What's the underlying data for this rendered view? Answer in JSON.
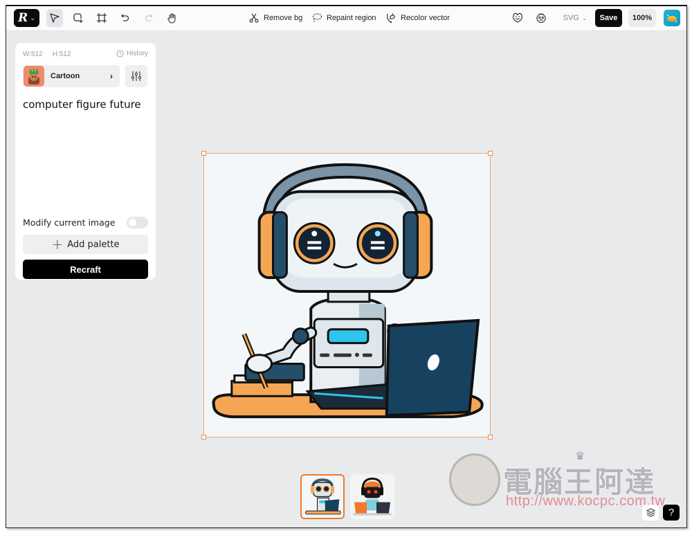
{
  "toolbar": {
    "logo": "R",
    "tools": [
      {
        "name": "select-tool",
        "active": true
      },
      {
        "name": "lasso-add-tool",
        "active": false
      },
      {
        "name": "frame-tool",
        "active": false
      },
      {
        "name": "undo",
        "active": false
      },
      {
        "name": "redo",
        "active": false,
        "disabled": true
      },
      {
        "name": "hand-tool",
        "active": false
      }
    ],
    "actions": {
      "remove_bg": "Remove bg",
      "repaint_region": "Repaint region",
      "recolor_vector": "Recolor vector"
    },
    "export_format": "SVG",
    "save_label": "Save",
    "zoom_level": "100%"
  },
  "panel": {
    "width_label": "W:512",
    "height_label": "H:512",
    "history_label": "History",
    "style_label": "Cartoon",
    "prompt": "computer figure future",
    "modify_label": "Modify current image",
    "modify_enabled": false,
    "add_palette_label": "Add palette",
    "recraft_label": "Recraft"
  },
  "canvas": {
    "image_description": "Cartoon robot with headphones using a laptop at a desk",
    "selected": true
  },
  "thumbnails": [
    {
      "description": "Robot with headphones, laptop and pen",
      "selected": true
    },
    {
      "description": "Black-faced robot with orange headphones and laptops",
      "selected": false
    }
  ],
  "bottom_controls": {
    "help_label": "?"
  },
  "watermark": {
    "title": "電腦王阿達",
    "url": "http://www.kocpc.com.tw"
  },
  "colors": {
    "accent": "#f07a2a",
    "primary_button": "#000000",
    "canvas_bg": "#e9eaec"
  }
}
